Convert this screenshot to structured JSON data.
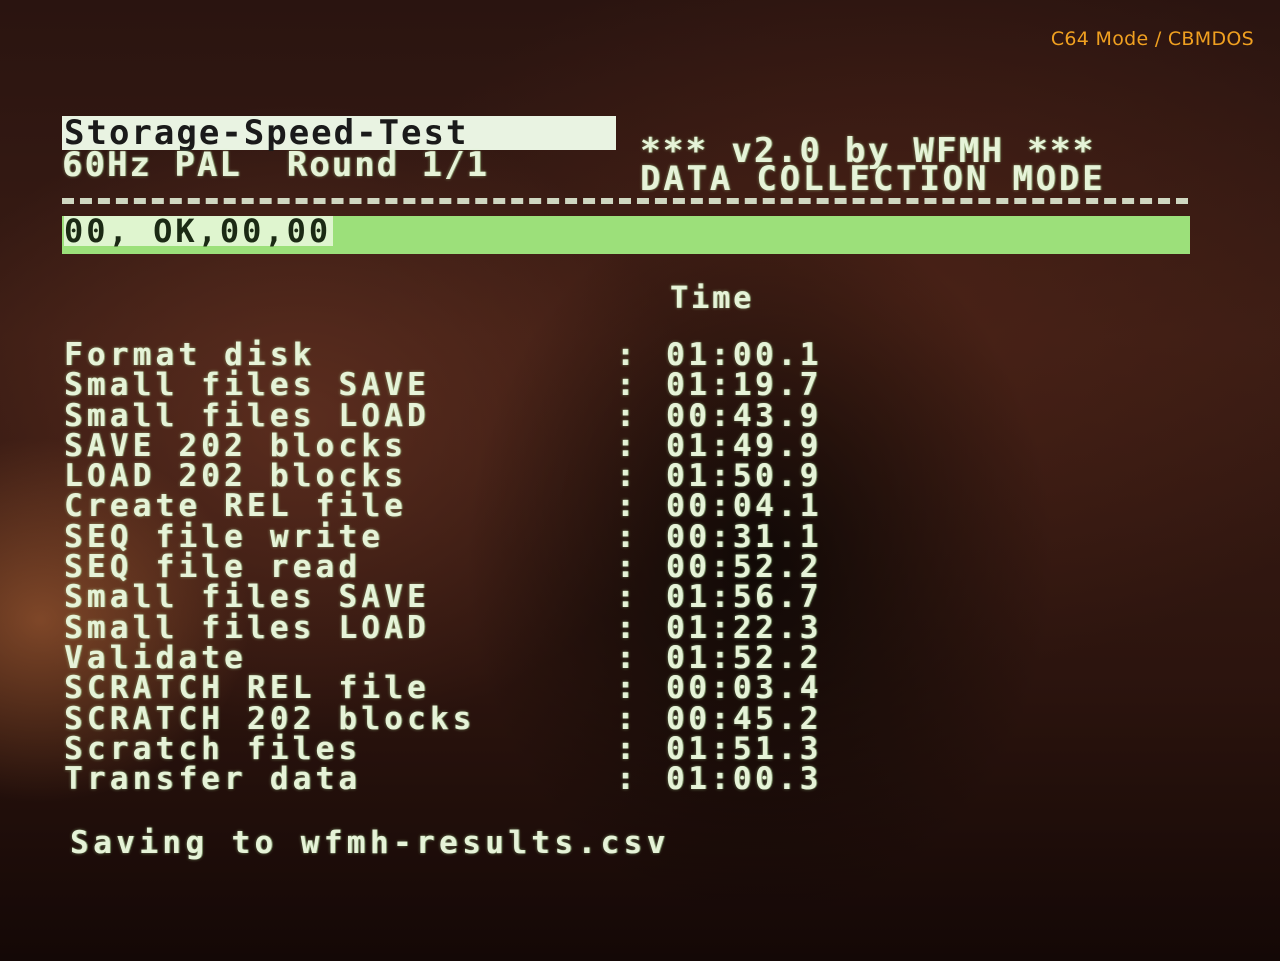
{
  "overlay": {
    "label": "C64 Mode / CBMDOS"
  },
  "header": {
    "title": "Storage-Speed-Test",
    "version_text": "*** v2.0 by WFMH ***",
    "video_mode": "60Hz PAL",
    "round": "Round 1/1",
    "mode": "DATA COLLECTION MODE"
  },
  "status": {
    "drive_status": "00, OK,00,00"
  },
  "results": {
    "column_header": "Time",
    "separator": ":",
    "rows": [
      {
        "label": "Format disk",
        "time": "01:00.1"
      },
      {
        "label": "Small files SAVE",
        "time": "01:19.7"
      },
      {
        "label": "Small files LOAD",
        "time": "00:43.9"
      },
      {
        "label": "SAVE 202 blocks",
        "time": "01:49.9"
      },
      {
        "label": "LOAD 202 blocks",
        "time": "01:50.9"
      },
      {
        "label": "Create REL file",
        "time": "00:04.1"
      },
      {
        "label": "SEQ file write",
        "time": "00:31.1"
      },
      {
        "label": "SEQ file read",
        "time": "00:52.2"
      },
      {
        "label": "Small files SAVE",
        "time": "01:56.7"
      },
      {
        "label": "Small files LOAD",
        "time": "01:22.3"
      },
      {
        "label": "Validate",
        "time": "01:52.2"
      },
      {
        "label": "SCRATCH REL file",
        "time": "00:03.4"
      },
      {
        "label": "SCRATCH 202 blocks",
        "time": "00:45.2"
      },
      {
        "label": "Scratch files",
        "time": "01:51.3"
      },
      {
        "label": "Transfer data",
        "time": "01:00.3"
      }
    ]
  },
  "footer": {
    "saving_text": "Saving to wfmh-results.csv"
  },
  "colors": {
    "overlay_text": "#f0a020",
    "screen_text": "#e6f3d8",
    "status_bar": "#9ce07a"
  }
}
